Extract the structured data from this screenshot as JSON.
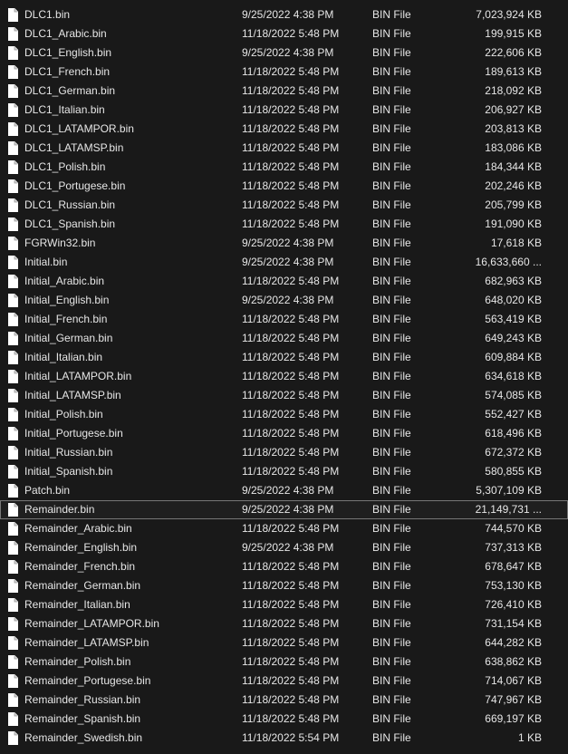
{
  "files": [
    {
      "name": "DLC1.bin",
      "date": "9/25/2022 4:38 PM",
      "type": "BIN File",
      "size": "7,023,924 KB",
      "icon": "file-icon"
    },
    {
      "name": "DLC1_Arabic.bin",
      "date": "11/18/2022 5:48 PM",
      "type": "BIN File",
      "size": "199,915 KB",
      "icon": "file-icon"
    },
    {
      "name": "DLC1_English.bin",
      "date": "9/25/2022 4:38 PM",
      "type": "BIN File",
      "size": "222,606 KB",
      "icon": "file-icon"
    },
    {
      "name": "DLC1_French.bin",
      "date": "11/18/2022 5:48 PM",
      "type": "BIN File",
      "size": "189,613 KB",
      "icon": "file-icon"
    },
    {
      "name": "DLC1_German.bin",
      "date": "11/18/2022 5:48 PM",
      "type": "BIN File",
      "size": "218,092 KB",
      "icon": "file-icon"
    },
    {
      "name": "DLC1_Italian.bin",
      "date": "11/18/2022 5:48 PM",
      "type": "BIN File",
      "size": "206,927 KB",
      "icon": "file-icon"
    },
    {
      "name": "DLC1_LATAMPOR.bin",
      "date": "11/18/2022 5:48 PM",
      "type": "BIN File",
      "size": "203,813 KB",
      "icon": "file-icon"
    },
    {
      "name": "DLC1_LATAMSP.bin",
      "date": "11/18/2022 5:48 PM",
      "type": "BIN File",
      "size": "183,086 KB",
      "icon": "file-icon"
    },
    {
      "name": "DLC1_Polish.bin",
      "date": "11/18/2022 5:48 PM",
      "type": "BIN File",
      "size": "184,344 KB",
      "icon": "file-icon"
    },
    {
      "name": "DLC1_Portugese.bin",
      "date": "11/18/2022 5:48 PM",
      "type": "BIN File",
      "size": "202,246 KB",
      "icon": "file-icon"
    },
    {
      "name": "DLC1_Russian.bin",
      "date": "11/18/2022 5:48 PM",
      "type": "BIN File",
      "size": "205,799 KB",
      "icon": "file-icon"
    },
    {
      "name": "DLC1_Spanish.bin",
      "date": "11/18/2022 5:48 PM",
      "type": "BIN File",
      "size": "191,090 KB",
      "icon": "file-icon"
    },
    {
      "name": "FGRWin32.bin",
      "date": "9/25/2022 4:38 PM",
      "type": "BIN File",
      "size": "17,618 KB",
      "icon": "file-icon"
    },
    {
      "name": "Initial.bin",
      "date": "9/25/2022 4:38 PM",
      "type": "BIN File",
      "size": "16,633,660 ...",
      "icon": "file-icon"
    },
    {
      "name": "Initial_Arabic.bin",
      "date": "11/18/2022 5:48 PM",
      "type": "BIN File",
      "size": "682,963 KB",
      "icon": "file-icon"
    },
    {
      "name": "Initial_English.bin",
      "date": "9/25/2022 4:38 PM",
      "type": "BIN File",
      "size": "648,020 KB",
      "icon": "file-icon"
    },
    {
      "name": "Initial_French.bin",
      "date": "11/18/2022 5:48 PM",
      "type": "BIN File",
      "size": "563,419 KB",
      "icon": "file-icon"
    },
    {
      "name": "Initial_German.bin",
      "date": "11/18/2022 5:48 PM",
      "type": "BIN File",
      "size": "649,243 KB",
      "icon": "file-icon"
    },
    {
      "name": "Initial_Italian.bin",
      "date": "11/18/2022 5:48 PM",
      "type": "BIN File",
      "size": "609,884 KB",
      "icon": "file-icon"
    },
    {
      "name": "Initial_LATAMPOR.bin",
      "date": "11/18/2022 5:48 PM",
      "type": "BIN File",
      "size": "634,618 KB",
      "icon": "file-icon"
    },
    {
      "name": "Initial_LATAMSP.bin",
      "date": "11/18/2022 5:48 PM",
      "type": "BIN File",
      "size": "574,085 KB",
      "icon": "file-icon"
    },
    {
      "name": "Initial_Polish.bin",
      "date": "11/18/2022 5:48 PM",
      "type": "BIN File",
      "size": "552,427 KB",
      "icon": "file-icon"
    },
    {
      "name": "Initial_Portugese.bin",
      "date": "11/18/2022 5:48 PM",
      "type": "BIN File",
      "size": "618,496 KB",
      "icon": "file-icon"
    },
    {
      "name": "Initial_Russian.bin",
      "date": "11/18/2022 5:48 PM",
      "type": "BIN File",
      "size": "672,372 KB",
      "icon": "file-icon"
    },
    {
      "name": "Initial_Spanish.bin",
      "date": "11/18/2022 5:48 PM",
      "type": "BIN File",
      "size": "580,855 KB",
      "icon": "file-icon"
    },
    {
      "name": "Patch.bin",
      "date": "9/25/2022 4:38 PM",
      "type": "BIN File",
      "size": "5,307,109 KB",
      "icon": "file-icon"
    },
    {
      "name": "Remainder.bin",
      "date": "9/25/2022 4:38 PM",
      "type": "BIN File",
      "size": "21,149,731 ...",
      "icon": "file-icon",
      "selected": true
    },
    {
      "name": "Remainder_Arabic.bin",
      "date": "11/18/2022 5:48 PM",
      "type": "BIN File",
      "size": "744,570 KB",
      "icon": "file-icon"
    },
    {
      "name": "Remainder_English.bin",
      "date": "9/25/2022 4:38 PM",
      "type": "BIN File",
      "size": "737,313 KB",
      "icon": "file-icon"
    },
    {
      "name": "Remainder_French.bin",
      "date": "11/18/2022 5:48 PM",
      "type": "BIN File",
      "size": "678,647 KB",
      "icon": "file-icon"
    },
    {
      "name": "Remainder_German.bin",
      "date": "11/18/2022 5:48 PM",
      "type": "BIN File",
      "size": "753,130 KB",
      "icon": "file-icon"
    },
    {
      "name": "Remainder_Italian.bin",
      "date": "11/18/2022 5:48 PM",
      "type": "BIN File",
      "size": "726,410 KB",
      "icon": "file-icon"
    },
    {
      "name": "Remainder_LATAMPOR.bin",
      "date": "11/18/2022 5:48 PM",
      "type": "BIN File",
      "size": "731,154 KB",
      "icon": "file-icon"
    },
    {
      "name": "Remainder_LATAMSP.bin",
      "date": "11/18/2022 5:48 PM",
      "type": "BIN File",
      "size": "644,282 KB",
      "icon": "file-icon"
    },
    {
      "name": "Remainder_Polish.bin",
      "date": "11/18/2022 5:48 PM",
      "type": "BIN File",
      "size": "638,862 KB",
      "icon": "file-icon"
    },
    {
      "name": "Remainder_Portugese.bin",
      "date": "11/18/2022 5:48 PM",
      "type": "BIN File",
      "size": "714,067 KB",
      "icon": "file-icon"
    },
    {
      "name": "Remainder_Russian.bin",
      "date": "11/18/2022 5:48 PM",
      "type": "BIN File",
      "size": "747,967 KB",
      "icon": "file-icon"
    },
    {
      "name": "Remainder_Spanish.bin",
      "date": "11/18/2022 5:48 PM",
      "type": "BIN File",
      "size": "669,197 KB",
      "icon": "file-icon"
    },
    {
      "name": "Remainder_Swedish.bin",
      "date": "11/18/2022 5:54 PM",
      "type": "BIN File",
      "size": "1 KB",
      "icon": "file-icon"
    }
  ],
  "colors": {
    "background": "#191919",
    "text": "#e6e6e6",
    "selection_border": "#777777",
    "icon_fill": "#ffffff"
  }
}
